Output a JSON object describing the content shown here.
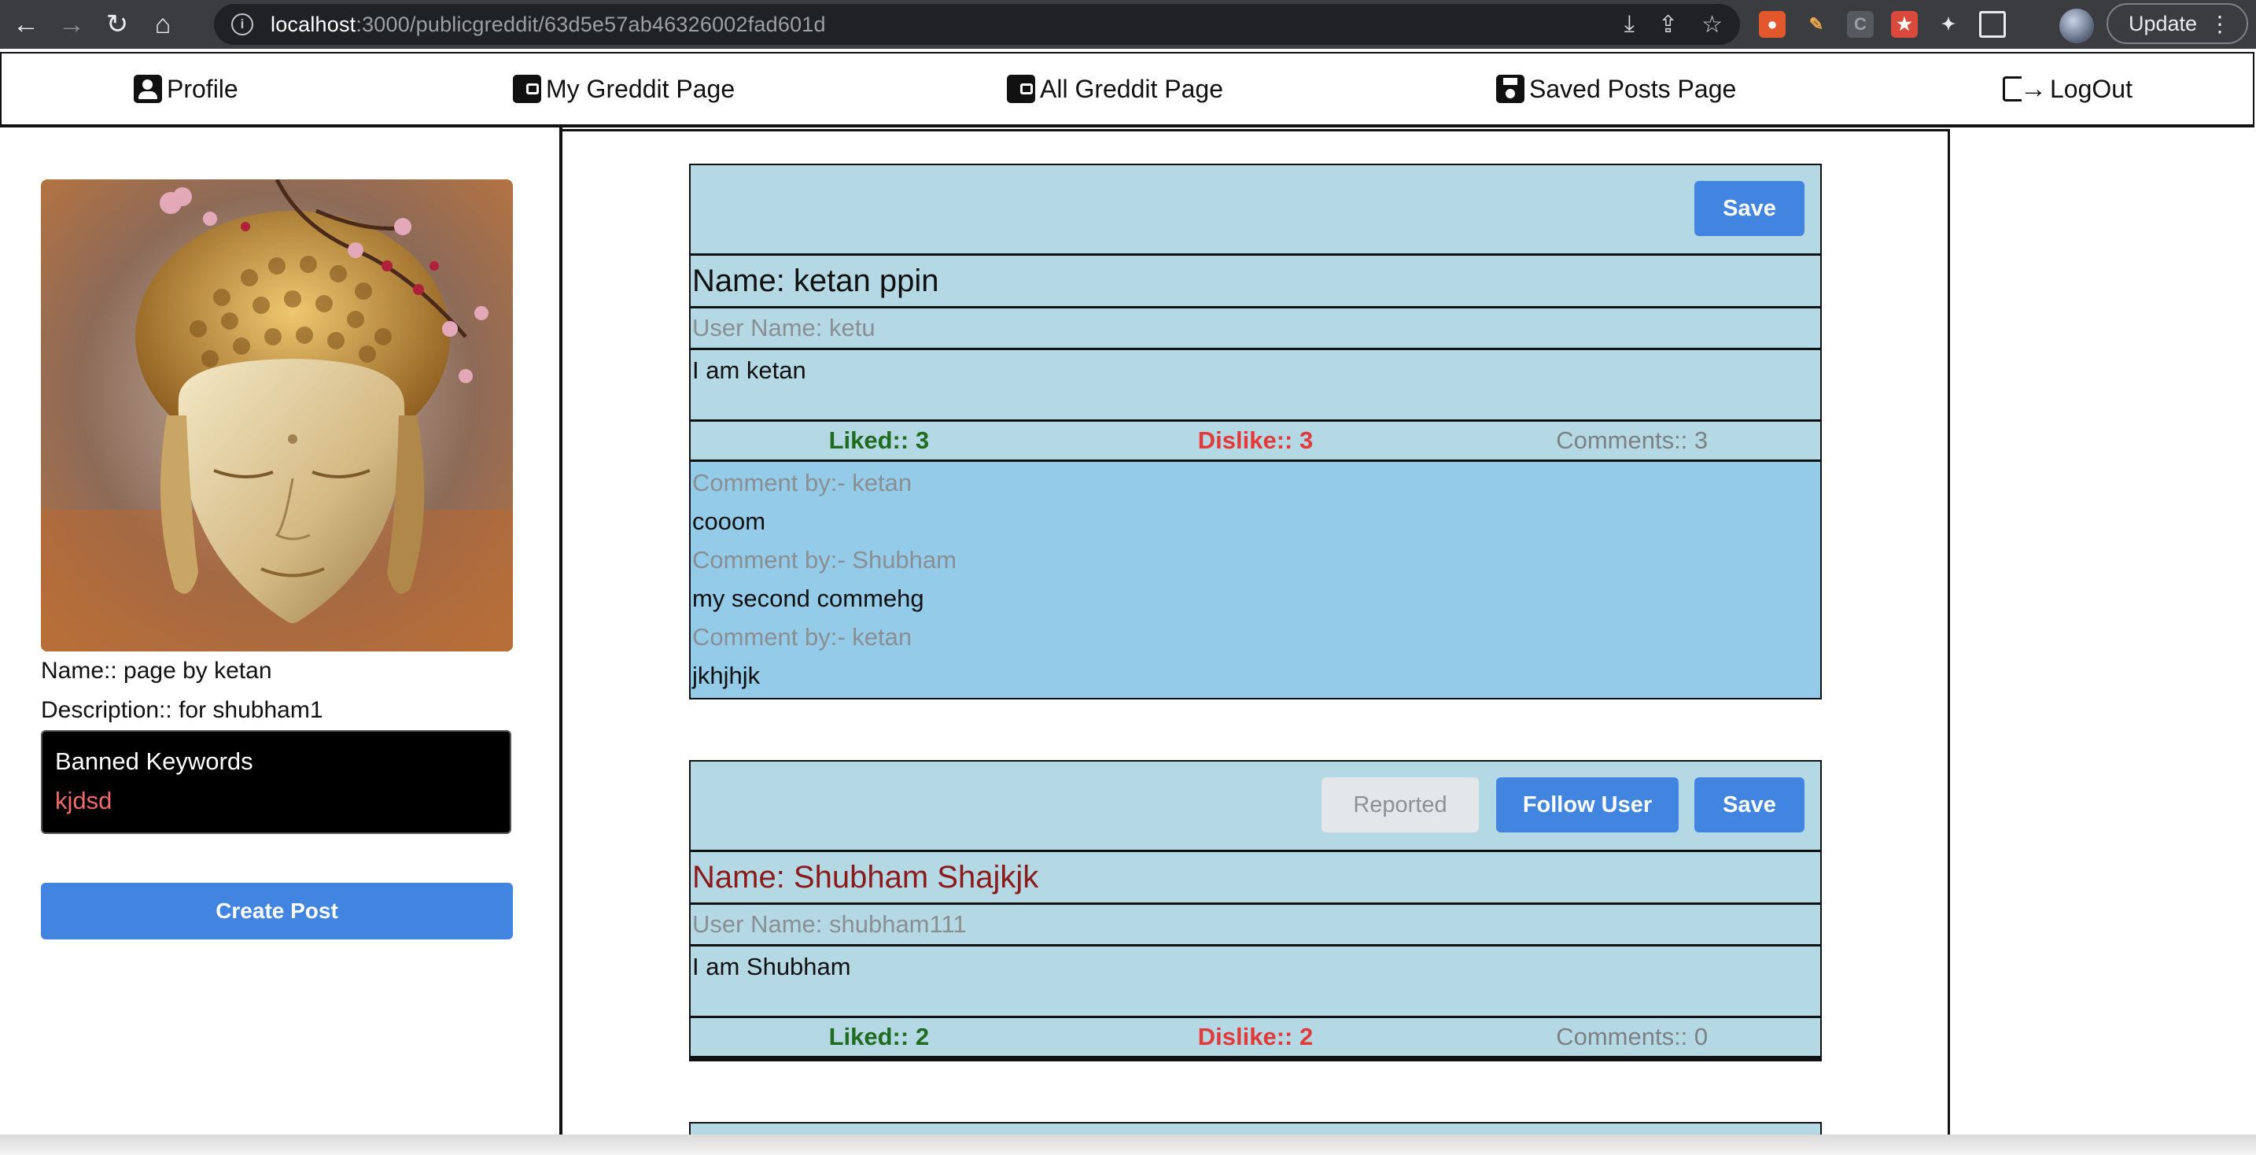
{
  "browser": {
    "url_host": "localhost",
    "url_path": ":3000/publicgreddit/63d5e57ab46326002fad601d",
    "update_label": "Update"
  },
  "nav": {
    "profile": "Profile",
    "my_greddit": "My Greddit Page",
    "all_greddit": "All Greddit Page",
    "saved_posts": "Saved Posts Page",
    "logout": "LogOut"
  },
  "sidebar": {
    "name": "Name:: page by ketan",
    "description": "Description:: for shubham1",
    "banned_title": "Banned Keywords",
    "banned_keywords": [
      "kjdsd"
    ],
    "create_post": "Create Post"
  },
  "posts": [
    {
      "save_label": "Save",
      "name": "Name: ketan ppin",
      "user": "User Name: ketu",
      "text": "I am ketan",
      "liked": "Liked:: 3",
      "dislike": "Dislike:: 3",
      "comments": "Comments:: 3",
      "comment_list": [
        {
          "by": "Comment by:- ketan",
          "text": "cooom"
        },
        {
          "by": "Comment by:- Shubham",
          "text": "my second commehg"
        },
        {
          "by": "Comment by:- ketan",
          "text": "jkhjhjk"
        }
      ]
    },
    {
      "reported_label": "Reported",
      "follow_label": "Follow User",
      "save_label": "Save",
      "name": "Name: Shubham Shajkjk",
      "user": "User Name: shubham111",
      "text": "I am Shubham",
      "liked": "Liked:: 2",
      "dislike": "Dislike:: 2",
      "comments": "Comments:: 0"
    }
  ],
  "colors": {
    "post_bg": "#b5d8e5",
    "comments_bg": "#94cbe8",
    "primary_button": "#4185e0",
    "liked": "#1f6b1f",
    "dislike": "#e23a3a",
    "post2_name": "#8b1a1a"
  }
}
